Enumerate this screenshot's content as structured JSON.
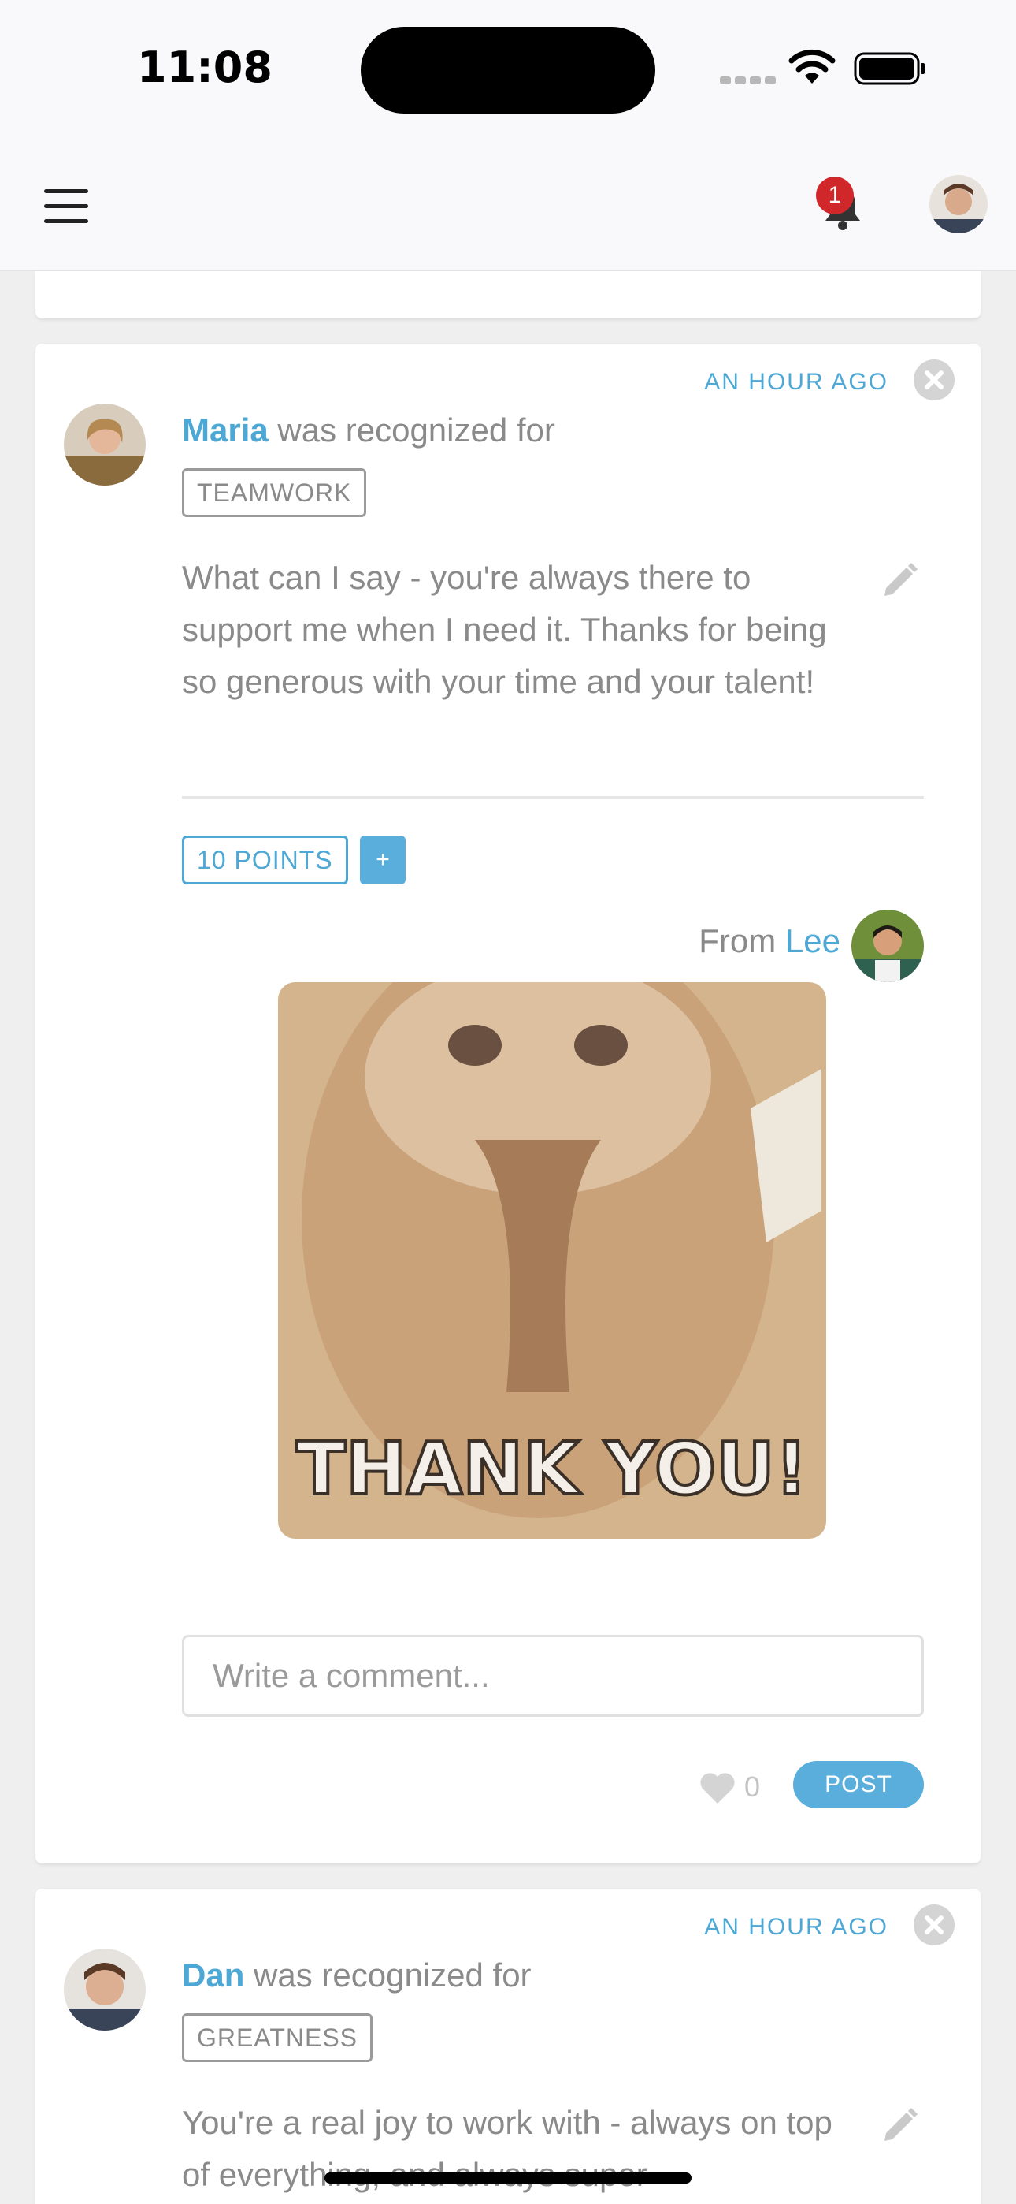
{
  "status_bar": {
    "time": "11:08"
  },
  "nav": {
    "notification_count": "1"
  },
  "cards": [
    {
      "time_ago": "AN HOUR AGO",
      "recipient": "Maria",
      "action": " was recognized for",
      "tag": "TEAMWORK",
      "message": "What can I say - you're always there to support me when I need it. Thanks for being so generous with your time and your talent!",
      "points": "10 POINTS",
      "plus_label": "+",
      "from_label": "From",
      "from_name": "Lee",
      "gif_text": "THANK YOU!",
      "comment_placeholder": "Write a comment...",
      "likes": "0",
      "post_label": "POST"
    },
    {
      "time_ago": "AN HOUR AGO",
      "recipient": "Dan",
      "action": " was recognized for",
      "tag": "GREATNESS",
      "message": "You're a real joy to work with - always on top of everything, and always super"
    }
  ],
  "colors": {
    "accent": "#4da8d6",
    "button": "#5aaedc",
    "badge": "#d0272b",
    "card": "#ffffff",
    "page": "#efefef"
  }
}
